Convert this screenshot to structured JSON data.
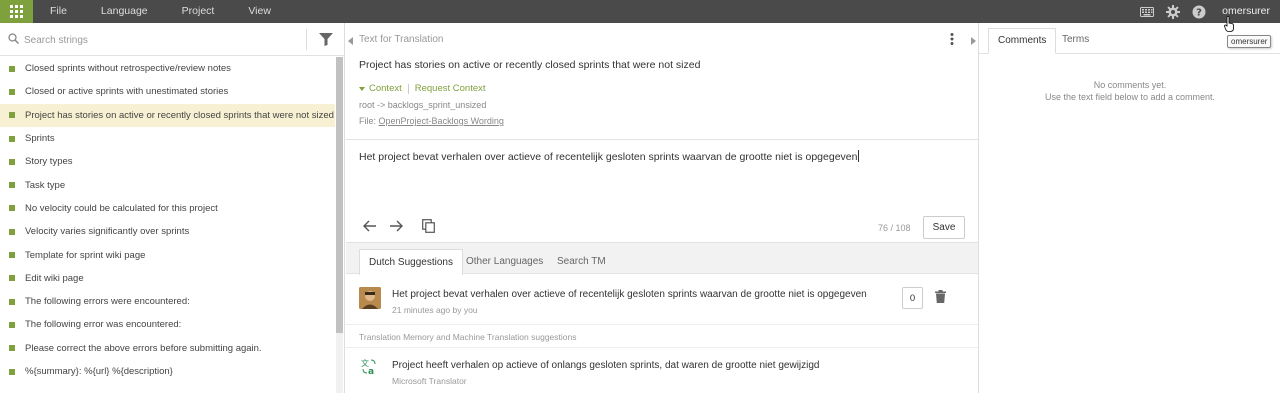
{
  "topbar": {
    "menu": [
      "File",
      "Language",
      "Project",
      "View"
    ],
    "username": "omersurer",
    "username_tooltip": "omersurer",
    "colors": {
      "bar": "#4a4a4a",
      "accent": "#7fa13d"
    }
  },
  "strings_panel": {
    "search_placeholder": "Search strings",
    "items": [
      "Closed sprints without retrospective/review notes",
      "Closed or active sprints with unestimated stories",
      "Project has stories on active or recently closed sprints that were not sized",
      "Sprints",
      "Story types",
      "Task type",
      "No velocity could be calculated for this project",
      "Velocity varies significantly over sprints",
      "Template for sprint wiki page",
      "Edit wiki page",
      "The following errors were encountered:",
      "The following error was encountered:",
      "Please correct the above errors before submitting again.",
      "%{summary}: %{url} %{description}"
    ],
    "selected_index": 2
  },
  "editor": {
    "heading": "Text for Translation",
    "source_text": "Project has stories on active or recently closed sprints that were not sized",
    "context_label": "Context",
    "request_context_label": "Request Context",
    "key_path": "root -> backlogs_sprint_unsized",
    "file_prefix": "File:",
    "file_name": "OpenProject-Backlogs Wording",
    "translation": "Het project bevat verhalen over actieve of recentelijk gesloten sprints waarvan de grootte niet is opgegeven",
    "counter": "76 / 108",
    "save_label": "Save"
  },
  "suggestions": {
    "tabs": [
      "Dutch Suggestions",
      "Other Languages",
      "Search TM"
    ],
    "active_tab": 0,
    "own": {
      "text": "Het project bevat verhalen over actieve of recentelijk gesloten sprints waarvan de grootte niet is opgegeven",
      "meta": "21 minutes ago by you",
      "votes": "0"
    },
    "tm_label": "Translation Memory and Machine Translation suggestions",
    "mt": {
      "text": "Project heeft verhalen op actieve of onlangs gesloten sprints, dat waren de grootte niet gewijzigd",
      "source": "Microsoft Translator"
    }
  },
  "comments_panel": {
    "tabs": [
      "Comments",
      "Terms"
    ],
    "empty_line1": "No comments yet.",
    "empty_line2": "Use the text field below to add a comment."
  }
}
